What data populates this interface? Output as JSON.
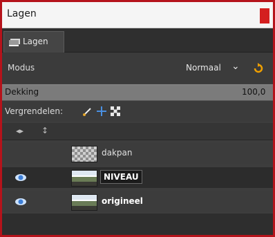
{
  "window": {
    "title": "Lagen"
  },
  "tab": {
    "label": "Lagen",
    "icon": "layers-icon"
  },
  "mode": {
    "label": "Modus",
    "value": "Normaal"
  },
  "opacity": {
    "label": "Dekking",
    "value": "100,0"
  },
  "lock": {
    "label": "Vergrendelen:",
    "icons": [
      "lock-pixels-icon",
      "lock-position-icon",
      "lock-alpha-icon"
    ]
  },
  "list": {
    "header_visibility": "◂▸",
    "header_chain": "↕"
  },
  "layers": [
    {
      "name": "dakpan",
      "visible": false,
      "selected": false,
      "thumb": "checker"
    },
    {
      "name": "NIVEAU",
      "visible": true,
      "selected": true,
      "thumb": "photo"
    },
    {
      "name": "origineel",
      "visible": true,
      "selected": false,
      "thumb": "photo"
    }
  ],
  "colors": {
    "frame_border": "#b5131b",
    "panel_bg": "#3d3d3d",
    "eye": "#5aa0f0"
  }
}
